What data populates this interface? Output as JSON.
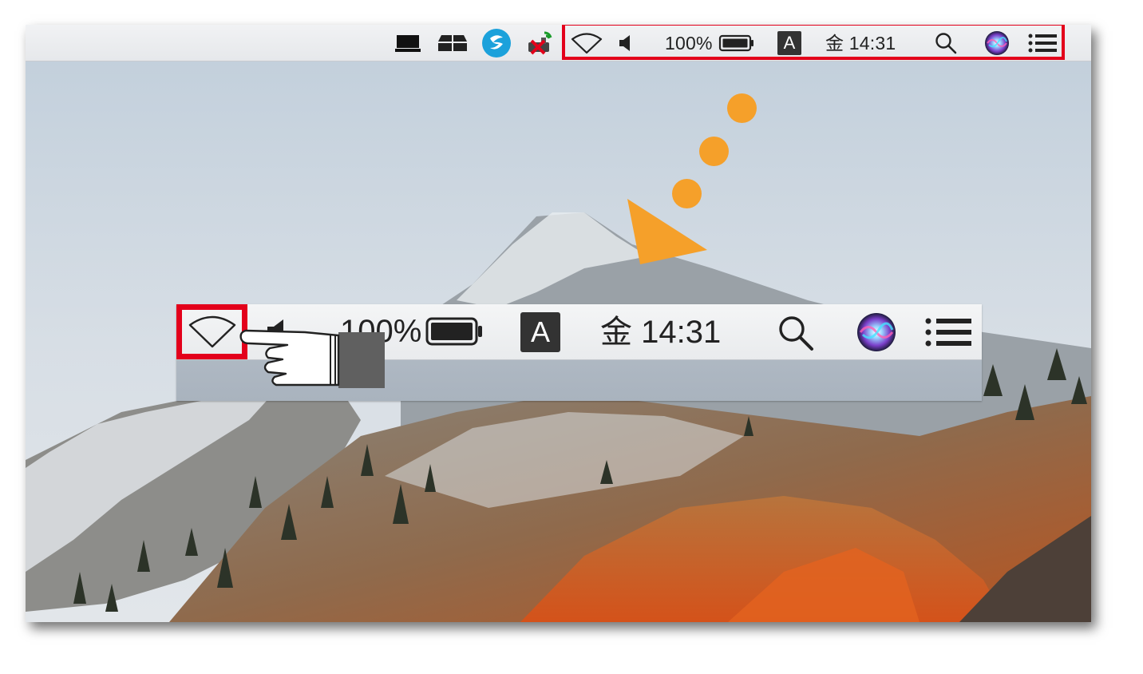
{
  "menubar": {
    "battery_percent": "100%",
    "input_source": "A",
    "clock": "金 14:31",
    "third_party_icons": [
      "laptop-display-icon",
      "stack-drive-icon",
      "seagate-icon",
      "wireless-device-error-icon"
    ],
    "system_icons": [
      "wifi-icon",
      "volume-icon",
      "battery-icon",
      "input-source-icon",
      "spotlight-search-icon",
      "siri-icon",
      "notification-center-icon"
    ]
  },
  "zoom_callout": {
    "battery_percent": "100%",
    "input_source": "A",
    "clock": "金 14:31"
  },
  "annotation": {
    "highlight_color": "#e3001b",
    "arrow_color": "#f5a02a",
    "pointer": "pointing-hand-icon"
  }
}
